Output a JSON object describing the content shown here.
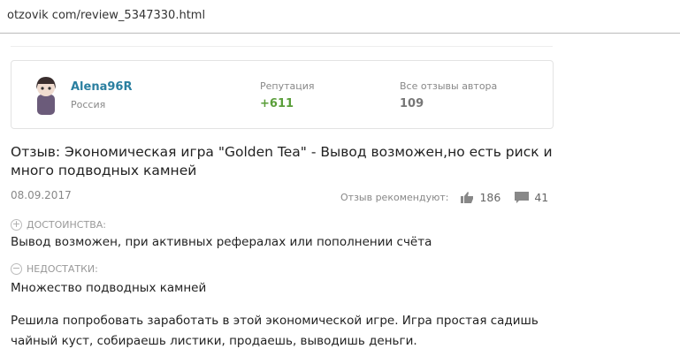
{
  "url": "otzovik com/review_5347330.html",
  "author": {
    "name": "Alena96R",
    "country": "Россия",
    "reputation_label": "Репутация",
    "reputation": "+611",
    "reviews_label": "Все отзывы автора",
    "reviews": "109"
  },
  "review": {
    "title": "Отзыв: Экономическая игра \"Golden Tea\" - Вывод возможен,но есть риск и много подводных камней",
    "date": "08.09.2017",
    "recommend_label": "Отзыв рекомендуют:",
    "likes": "186",
    "comments": "41",
    "pros_label": "ДОСТОИНСТВА:",
    "pros": "Вывод возможен, при активных рефералах или пополнении счёта",
    "cons_label": "НЕДОСТАТКИ:",
    "cons": "Множество подводных камней",
    "body": "Решила попробовать заработать в этой экономической игре. Игра простая садишь чайный куст, собираешь листики, продаешь, выводишь деньги."
  },
  "colors": {
    "link": "#2a7fa0",
    "positive": "#5a9e3a"
  }
}
